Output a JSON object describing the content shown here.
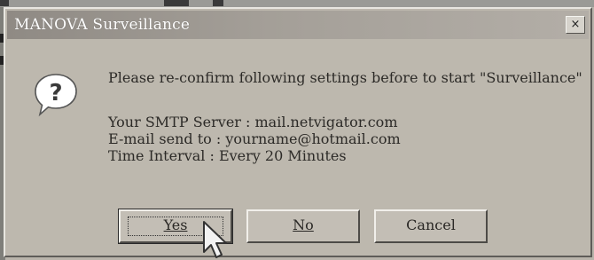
{
  "window": {
    "title": "MANOVA Surveillance",
    "close_glyph": "×"
  },
  "icon": {
    "name": "question-icon",
    "glyph": "?"
  },
  "message": "Please re-confirm following settings before to start \"Surveillance\"",
  "details": [
    "Your SMTP Server : mail.netvigator.com",
    "E-mail send to : yourname@hotmail.com",
    "Time Interval : Every 20 Minutes"
  ],
  "buttons": {
    "yes": "Yes",
    "no": "No",
    "cancel": "Cancel"
  },
  "colors": {
    "dialog_bg": "#bdb8ae",
    "titlebar": "#9c978f",
    "title_text": "#ffffff"
  }
}
